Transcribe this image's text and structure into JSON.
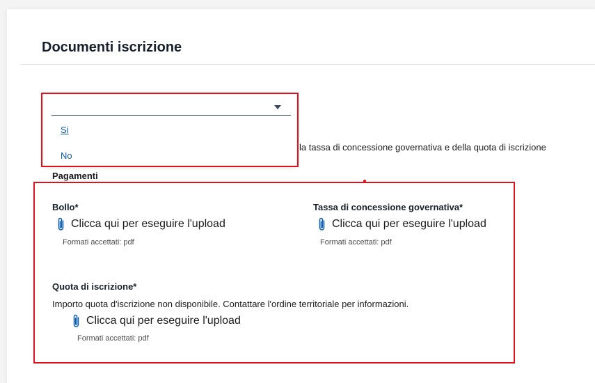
{
  "section": {
    "title": "Documenti iscrizione"
  },
  "dropdown": {
    "selected": "",
    "options": [
      "Si",
      "No"
    ]
  },
  "description": "la tassa di concessione governativa e della quota di iscrizione",
  "payments": {
    "title": "Pagamenti",
    "bollo": {
      "label": "Bollo*",
      "upload_text": "Clicca qui per eseguire l'upload",
      "formats": "Formati accettati: pdf"
    },
    "tassa": {
      "label": "Tassa di concessione governativa*",
      "upload_text": "Clicca qui per eseguire l'upload",
      "formats": "Formati accettati: pdf"
    },
    "quota": {
      "label": "Quota di iscrizione*",
      "note": "Importo quota d'iscrizione non disponibile. Contattare l'ordine territoriale per informazioni.",
      "upload_text": "Clicca qui per eseguire l'upload",
      "formats": "Formati accettati: pdf"
    }
  },
  "colors": {
    "accent": "#0b5cad",
    "highlight": "#e0101c",
    "title": "#17202b"
  },
  "icons": {
    "dropdown": "caret-down-icon",
    "upload": "paperclip-icon"
  }
}
